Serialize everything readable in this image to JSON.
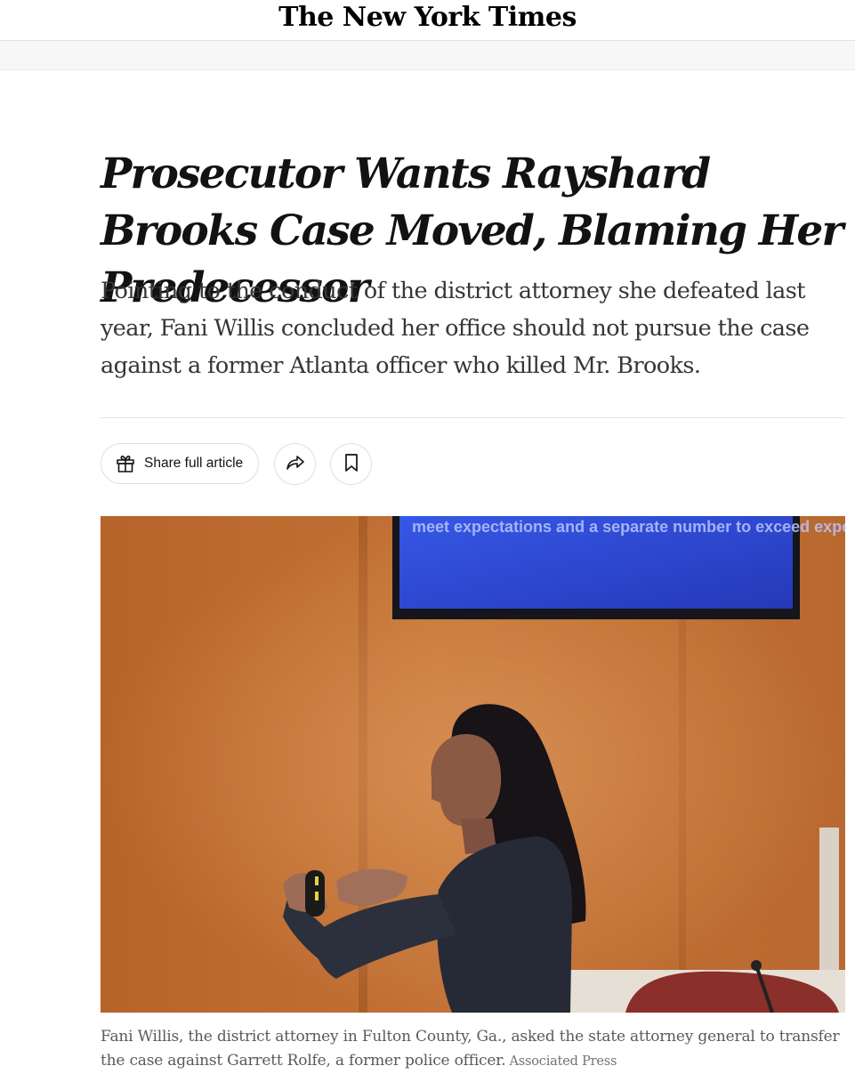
{
  "masthead": {
    "logo_text": "The New York Times"
  },
  "article": {
    "headline": "Prosecutor Wants Rayshard Brooks Case Moved, Blaming Her Predecessor",
    "summary": "Pointing to the conduct of the district attorney she defeated last year, Fani Willis concluded her office should not pursue the case against a former Atlanta officer who killed Mr. Brooks.",
    "caption": "Fani Willis, the district attorney in Fulton County, Ga., asked the state attorney general to transfer the case against Garrett Rolfe, a former police officer.",
    "credit": "Associated Press"
  },
  "toolbar": {
    "share_label": "Share full article"
  },
  "photo": {
    "screen_text": "meet expectations and a separate number to exceed expectations"
  },
  "colors": {
    "wall": "#b8672e",
    "screen": "#2f4fd8",
    "suit": "#262a36"
  },
  "icons": [
    "gift-icon",
    "share-arrow-icon",
    "bookmark-icon"
  ]
}
